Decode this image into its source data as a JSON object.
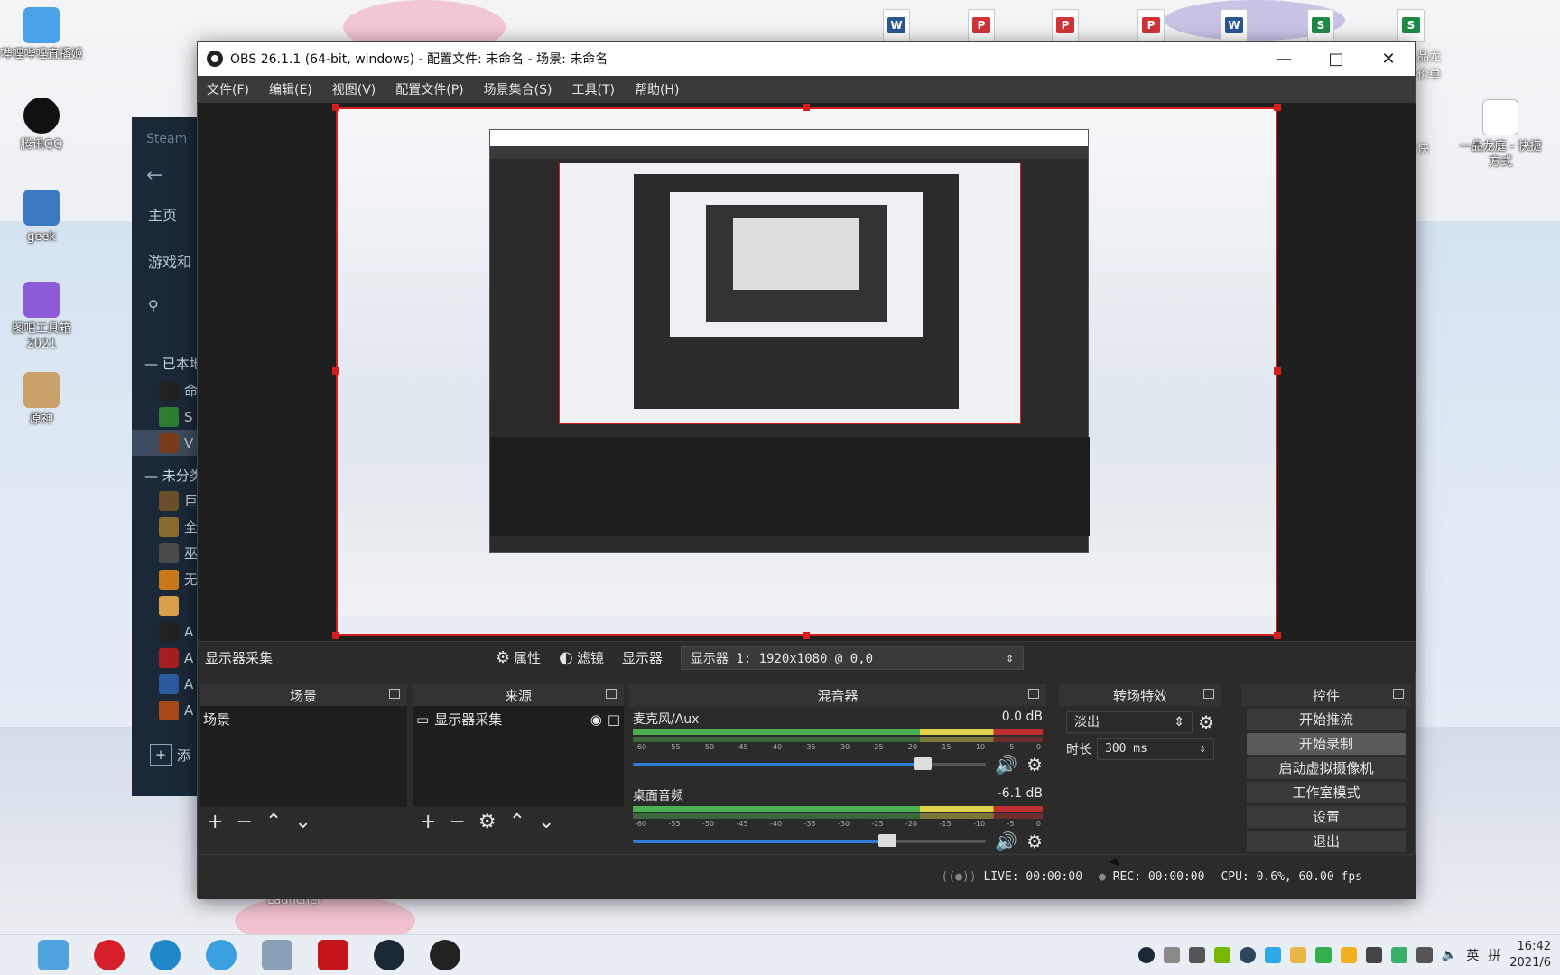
{
  "desktop": {
    "icons_left": [
      {
        "label": "哔哩哔哩直播姬",
        "icon": "bilibili-live-icon",
        "color": "#4aa3e8"
      },
      {
        "label": "腾讯QQ",
        "icon": "qq-icon",
        "color": "#111111"
      },
      {
        "label": "geek",
        "icon": "geek-icon",
        "color": "#3b78c4"
      },
      {
        "label": "图吧工具箱2021",
        "icon": "toolbox-icon",
        "color": "#8c5bd8"
      },
      {
        "label": "原神",
        "icon": "genshin-icon",
        "color": "#c9a26b"
      }
    ],
    "icons_right": [
      {
        "label": "一品龙庭 - 快捷方式",
        "icon": "shortcut-icon"
      }
    ],
    "partial_labels": {
      "top_right_a": "品龙",
      "top_right_b": "价单",
      "right_fragment": "快",
      "launcher": "Launcher"
    }
  },
  "steam": {
    "title": "Steam",
    "home": "主页",
    "games": "游戏和",
    "installed_header": "已本地",
    "uncat_header": "未分类",
    "add_label": "添",
    "installed_games": [
      {
        "initial": "命",
        "color": "#222222"
      },
      {
        "initial": "S",
        "color": "#2e7d32"
      },
      {
        "initial": "V",
        "color": "#7a3b1a"
      }
    ],
    "uncat_games": [
      {
        "initial": "巨",
        "color": "#6b4e2a"
      },
      {
        "initial": "全",
        "color": "#8a6b2e"
      },
      {
        "initial": "巫",
        "color": "#4b4b4b"
      },
      {
        "initial": "无",
        "color": "#c87a1a"
      },
      {
        "initial": "",
        "color": "#d8a04a"
      },
      {
        "initial": "A",
        "color": "#222222"
      },
      {
        "initial": "A",
        "color": "#a61d1d"
      },
      {
        "initial": "A",
        "color": "#2c5aa0"
      },
      {
        "initial": "A",
        "color": "#a84a1a"
      }
    ]
  },
  "obs": {
    "title": "OBS 26.1.1 (64-bit, windows) - 配置文件: 未命名 - 场景: 未命名",
    "menu": [
      "文件(F)",
      "编辑(E)",
      "视图(V)",
      "配置文件(P)",
      "场景集合(S)",
      "工具(T)",
      "帮助(H)"
    ],
    "source_bar": {
      "name": "显示器采集",
      "properties": "属性",
      "filters": "滤镜",
      "display_label": "显示器",
      "display_value": "显示器 1: 1920x1080 @ 0,0"
    },
    "docks": {
      "scenes": {
        "title": "场景",
        "items": [
          "场景"
        ]
      },
      "sources": {
        "title": "来源",
        "items": [
          "显示器采集"
        ]
      },
      "mixer": {
        "title": "混音器",
        "channels": [
          {
            "name": "麦克风/Aux",
            "db": "0.0 dB",
            "level": 0.82
          },
          {
            "name": "桌面音频",
            "db": "-6.1 dB",
            "level": 0.72
          }
        ],
        "ticks": [
          "-60",
          "-55",
          "-50",
          "-45",
          "-40",
          "-35",
          "-30",
          "-25",
          "-20",
          "-15",
          "-10",
          "-5",
          "0"
        ]
      },
      "transitions": {
        "title": "转场特效",
        "value": "淡出",
        "duration_label": "时长",
        "duration_value": "300 ms"
      },
      "controls": {
        "title": "控件",
        "buttons": [
          "开始推流",
          "开始录制",
          "启动虚拟摄像机",
          "工作室模式",
          "设置",
          "退出"
        ]
      }
    },
    "status": {
      "live": "LIVE: 00:00:00",
      "rec": "REC: 00:00:00",
      "cpu": "CPU: 0.6%, 60.00 fps"
    }
  },
  "taskbar": {
    "apps": [
      {
        "icon": "folder-icon",
        "color": "#4fa3e0"
      },
      {
        "icon": "netease-music-icon",
        "color": "#d71f2b"
      },
      {
        "icon": "edge-icon",
        "color": "#1e88c8"
      },
      {
        "icon": "network-icon",
        "color": "#3aa0e0"
      },
      {
        "icon": "calculator-icon",
        "color": "#8aa0b8"
      },
      {
        "icon": "autocad-icon",
        "color": "#c4161c"
      },
      {
        "icon": "steam-icon",
        "color": "#1b2838"
      },
      {
        "icon": "obs-icon",
        "color": "#222222"
      }
    ],
    "tray": {
      "ime_lang": "英",
      "ime_mode": "拼"
    },
    "clock_time": "16:42",
    "clock_date": "2021/6"
  }
}
